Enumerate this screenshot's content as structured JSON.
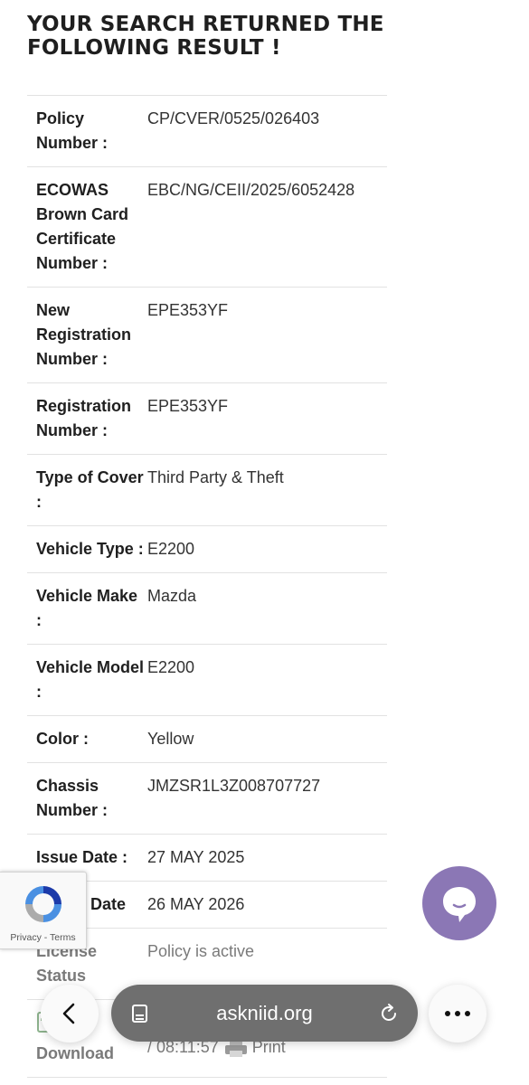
{
  "heading": "YOUR SEARCH RETURNED THE FOLLOWING RESULT !",
  "rows": [
    {
      "label": "Policy Number :",
      "value": "CP/CVER/0525/026403"
    },
    {
      "label": "ECOWAS Brown Card Certificate Number :",
      "value": "EBC/NG/CEII/2025/6052428"
    },
    {
      "label": "New Registration Number :",
      "value": "EPE353YF"
    },
    {
      "label": "Registration Number :",
      "value": "EPE353YF"
    },
    {
      "label": "Type of Cover :",
      "value": "Third Party & Theft"
    },
    {
      "label": "Vehicle Type :",
      "value": "E2200"
    },
    {
      "label": "Vehicle Make :",
      "value": "Mazda"
    },
    {
      "label": "Vehicle Model :",
      "value": "E2200"
    },
    {
      "label": "Color :",
      "value": "Yellow"
    },
    {
      "label": "Chassis Number :",
      "value": "JMZSR1L3Z008707727"
    },
    {
      "label": "Issue Date :",
      "value": "27 MAY 2025"
    },
    {
      "label": "Expiry Date",
      "value": "26 MAY 2026"
    },
    {
      "label": "License Status",
      "value": "Policy is active"
    },
    {
      "label": "Download",
      "value": "Upload Date/Time: 27 MAY 2025 / 08:11:57",
      "action": "Print"
    }
  ],
  "recaptcha": {
    "privacy": "Privacy",
    "separator": " - ",
    "terms": "Terms"
  },
  "browser": {
    "url": "askniid.org"
  },
  "icons": {
    "chat": "chat-bubble-icon",
    "back": "chevron-left-icon",
    "tabs": "tabs-icon",
    "reload": "reload-icon",
    "more": "more-icon",
    "recaptcha": "recaptcha-logo-icon",
    "print": "printer-icon",
    "download": "file-icon"
  },
  "colors": {
    "chat": "#8b77b5",
    "url_bar": "#6f6f6f"
  }
}
